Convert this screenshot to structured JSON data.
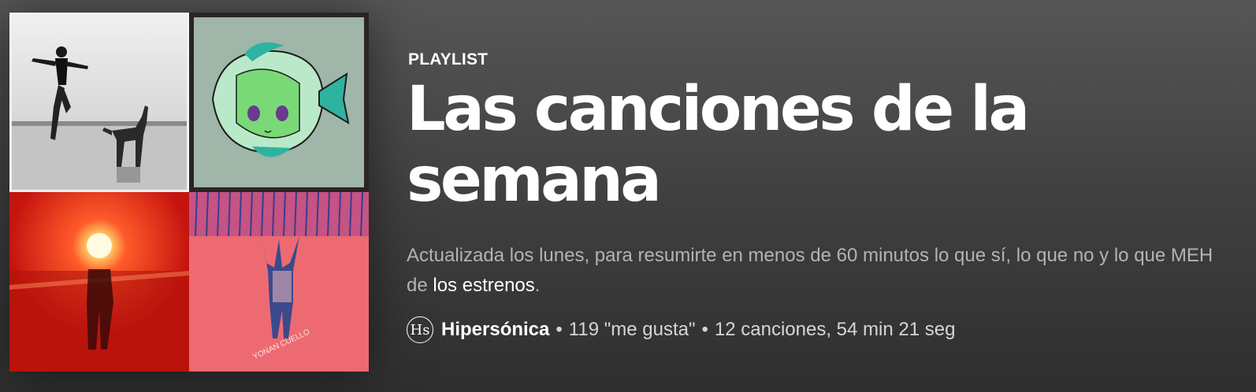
{
  "header": {
    "type_label": "PLAYLIST",
    "title": "Las canciones de la semana",
    "description_prefix": "Actualizada los lunes, para resumirte en menos de 60 minutos lo que sí, lo que no y lo que MEH de ",
    "description_link": "los estrenos",
    "description_suffix": ".",
    "owner_avatar_text": "Hs",
    "owner_name": "Hipersónica",
    "likes": "119 \"me gusta\"",
    "summary": "12 canciones, 54 min 21 seg",
    "separator": "•"
  },
  "cover": {
    "tiles": [
      {
        "name": "album-art-beach-dog",
        "accent": "#9a9a9a"
      },
      {
        "name": "album-art-fish-drawing",
        "accent": "#2fb3a0"
      },
      {
        "name": "album-art-red-light-figure",
        "accent": "#d8281c"
      },
      {
        "name": "album-art-pink-jumper",
        "accent": "#ee6a72"
      }
    ],
    "text_on_art": "YONAN CUELLO"
  }
}
